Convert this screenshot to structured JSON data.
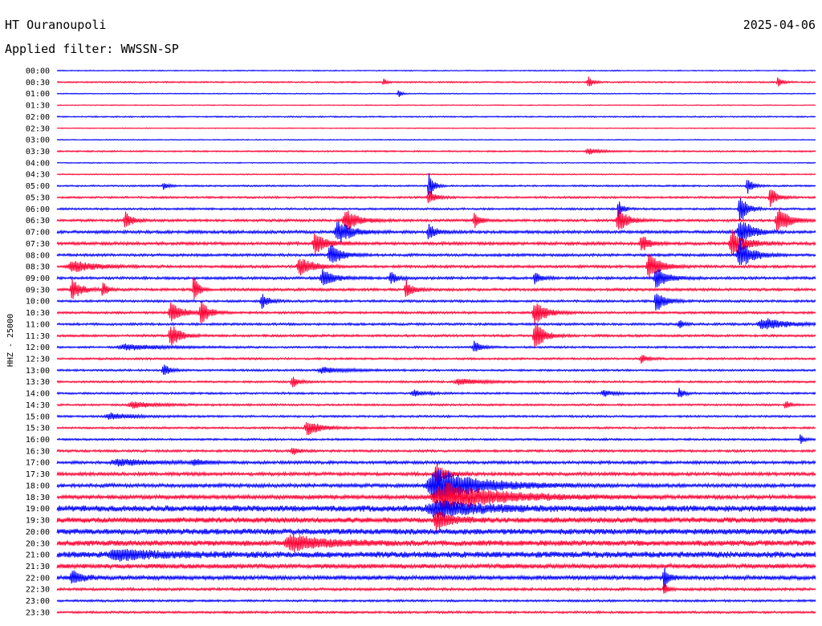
{
  "chart_data": {
    "type": "line",
    "title": "HT Ouranoupoli",
    "subtitle": "Applied filter: WWSSN-SP",
    "date": "2025-04-06",
    "ylabel": "HHZ - 25000",
    "grid": false,
    "series_colors": [
      "#0000ff",
      "#ff0033"
    ],
    "rows": [
      "00:00",
      "00:30",
      "01:00",
      "01:30",
      "02:00",
      "02:30",
      "03:00",
      "03:30",
      "04:00",
      "04:30",
      "05:00",
      "05:30",
      "06:00",
      "06:30",
      "07:00",
      "07:30",
      "08:00",
      "08:30",
      "09:00",
      "09:30",
      "10:00",
      "10:30",
      "11:00",
      "11:30",
      "12:00",
      "12:30",
      "13:00",
      "13:30",
      "14:00",
      "14:30",
      "15:00",
      "15:30",
      "16:00",
      "16:30",
      "17:00",
      "17:30",
      "18:00",
      "18:30",
      "19:00",
      "19:30",
      "20:00",
      "20:30",
      "21:00",
      "21:30",
      "22:00",
      "22:30",
      "23:00",
      "23:30"
    ],
    "row_noise": [
      0.6,
      0.9,
      0.6,
      0.5,
      0.8,
      0.5,
      0.6,
      0.9,
      0.6,
      0.7,
      1.0,
      1.2,
      1.2,
      1.5,
      1.8,
      1.8,
      1.6,
      1.6,
      1.6,
      1.6,
      1.4,
      1.4,
      1.4,
      1.4,
      1.2,
      1.2,
      1.2,
      1.2,
      1.2,
      1.2,
      1.2,
      1.2,
      1.2,
      1.4,
      1.8,
      2.0,
      2.2,
      2.4,
      3.8,
      3.4,
      3.6,
      3.4,
      3.8,
      2.8,
      2.6,
      1.6,
      1.3,
      1.3
    ],
    "events": [
      {
        "row": 1,
        "pos": 0.7,
        "amp": 8,
        "width": 0.004
      },
      {
        "row": 1,
        "pos": 0.95,
        "amp": 7,
        "width": 0.004
      },
      {
        "row": 1,
        "pos": 0.43,
        "amp": 5,
        "width": 0.003
      },
      {
        "row": 2,
        "pos": 0.45,
        "amp": 5,
        "width": 0.003
      },
      {
        "row": 7,
        "pos": 0.7,
        "amp": 4,
        "width": 0.01
      },
      {
        "row": 10,
        "pos": 0.14,
        "amp": 6,
        "width": 0.004
      },
      {
        "row": 10,
        "pos": 0.49,
        "amp": 22,
        "width": 0.004
      },
      {
        "row": 10,
        "pos": 0.91,
        "amp": 10,
        "width": 0.005
      },
      {
        "row": 11,
        "pos": 0.49,
        "amp": 10,
        "width": 0.006
      },
      {
        "row": 11,
        "pos": 0.94,
        "amp": 14,
        "width": 0.006
      },
      {
        "row": 12,
        "pos": 0.9,
        "amp": 22,
        "width": 0.006
      },
      {
        "row": 12,
        "pos": 0.74,
        "amp": 12,
        "width": 0.004
      },
      {
        "row": 13,
        "pos": 0.09,
        "amp": 12,
        "width": 0.006
      },
      {
        "row": 13,
        "pos": 0.38,
        "amp": 14,
        "width": 0.012
      },
      {
        "row": 13,
        "pos": 0.55,
        "amp": 10,
        "width": 0.006
      },
      {
        "row": 13,
        "pos": 0.74,
        "amp": 18,
        "width": 0.008
      },
      {
        "row": 13,
        "pos": 0.95,
        "amp": 18,
        "width": 0.01
      },
      {
        "row": 14,
        "pos": 0.37,
        "amp": 16,
        "width": 0.012
      },
      {
        "row": 14,
        "pos": 0.49,
        "amp": 12,
        "width": 0.006
      },
      {
        "row": 14,
        "pos": 0.9,
        "amp": 20,
        "width": 0.01
      },
      {
        "row": 15,
        "pos": 0.34,
        "amp": 14,
        "width": 0.01
      },
      {
        "row": 15,
        "pos": 0.77,
        "amp": 14,
        "width": 0.006
      },
      {
        "row": 15,
        "pos": 0.89,
        "amp": 18,
        "width": 0.012
      },
      {
        "row": 16,
        "pos": 0.36,
        "amp": 14,
        "width": 0.01
      },
      {
        "row": 16,
        "pos": 0.9,
        "amp": 18,
        "width": 0.012
      },
      {
        "row": 17,
        "pos": 0.02,
        "amp": 8,
        "width": 0.02
      },
      {
        "row": 17,
        "pos": 0.32,
        "amp": 12,
        "width": 0.012
      },
      {
        "row": 17,
        "pos": 0.78,
        "amp": 18,
        "width": 0.01
      },
      {
        "row": 18,
        "pos": 0.35,
        "amp": 12,
        "width": 0.01
      },
      {
        "row": 18,
        "pos": 0.44,
        "amp": 8,
        "width": 0.006
      },
      {
        "row": 18,
        "pos": 0.63,
        "amp": 8,
        "width": 0.006
      },
      {
        "row": 18,
        "pos": 0.79,
        "amp": 14,
        "width": 0.01
      },
      {
        "row": 19,
        "pos": 0.02,
        "amp": 14,
        "width": 0.008
      },
      {
        "row": 19,
        "pos": 0.06,
        "amp": 10,
        "width": 0.004
      },
      {
        "row": 19,
        "pos": 0.18,
        "amp": 24,
        "width": 0.004
      },
      {
        "row": 19,
        "pos": 0.46,
        "amp": 12,
        "width": 0.006
      },
      {
        "row": 20,
        "pos": 0.27,
        "amp": 10,
        "width": 0.006
      },
      {
        "row": 20,
        "pos": 0.79,
        "amp": 14,
        "width": 0.008
      },
      {
        "row": 21,
        "pos": 0.15,
        "amp": 14,
        "width": 0.01
      },
      {
        "row": 21,
        "pos": 0.19,
        "amp": 14,
        "width": 0.008
      },
      {
        "row": 21,
        "pos": 0.63,
        "amp": 16,
        "width": 0.01
      },
      {
        "row": 22,
        "pos": 0.93,
        "amp": 8,
        "width": 0.02
      },
      {
        "row": 22,
        "pos": 0.82,
        "amp": 6,
        "width": 0.004
      },
      {
        "row": 23,
        "pos": 0.15,
        "amp": 16,
        "width": 0.008
      },
      {
        "row": 23,
        "pos": 0.63,
        "amp": 20,
        "width": 0.008
      },
      {
        "row": 24,
        "pos": 0.09,
        "amp": 4,
        "width": 0.03
      },
      {
        "row": 24,
        "pos": 0.55,
        "amp": 8,
        "width": 0.006
      },
      {
        "row": 25,
        "pos": 0.77,
        "amp": 6,
        "width": 0.006
      },
      {
        "row": 26,
        "pos": 0.14,
        "amp": 8,
        "width": 0.006
      },
      {
        "row": 26,
        "pos": 0.35,
        "amp": 4,
        "width": 0.02
      },
      {
        "row": 27,
        "pos": 0.31,
        "amp": 7,
        "width": 0.006
      },
      {
        "row": 27,
        "pos": 0.53,
        "amp": 4,
        "width": 0.02
      },
      {
        "row": 28,
        "pos": 0.47,
        "amp": 4,
        "width": 0.01
      },
      {
        "row": 28,
        "pos": 0.72,
        "amp": 4,
        "width": 0.01
      },
      {
        "row": 28,
        "pos": 0.82,
        "amp": 8,
        "width": 0.004
      },
      {
        "row": 29,
        "pos": 0.1,
        "amp": 4,
        "width": 0.02
      },
      {
        "row": 29,
        "pos": 0.96,
        "amp": 7,
        "width": 0.004
      },
      {
        "row": 30,
        "pos": 0.07,
        "amp": 4,
        "width": 0.02
      },
      {
        "row": 31,
        "pos": 0.33,
        "amp": 10,
        "width": 0.012
      },
      {
        "row": 32,
        "pos": 0.98,
        "amp": 7,
        "width": 0.004
      },
      {
        "row": 33,
        "pos": 0.31,
        "amp": 5,
        "width": 0.006
      },
      {
        "row": 34,
        "pos": 0.08,
        "amp": 4,
        "width": 0.03
      },
      {
        "row": 34,
        "pos": 0.18,
        "amp": 4,
        "width": 0.01
      },
      {
        "row": 35,
        "pos": 0.5,
        "amp": 14,
        "width": 0.008
      },
      {
        "row": 36,
        "pos": 0.5,
        "amp": 22,
        "width": 0.04
      },
      {
        "row": 37,
        "pos": 0.51,
        "amp": 18,
        "width": 0.05
      },
      {
        "row": 38,
        "pos": 0.5,
        "amp": 10,
        "width": 0.04
      },
      {
        "row": 39,
        "pos": 0.5,
        "amp": 14,
        "width": 0.012
      },
      {
        "row": 41,
        "pos": 0.31,
        "amp": 10,
        "width": 0.03
      },
      {
        "row": 42,
        "pos": 0.08,
        "amp": 6,
        "width": 0.04
      },
      {
        "row": 44,
        "pos": 0.02,
        "amp": 8,
        "width": 0.01
      },
      {
        "row": 44,
        "pos": 0.8,
        "amp": 14,
        "width": 0.004
      },
      {
        "row": 45,
        "pos": 0.8,
        "amp": 8,
        "width": 0.004
      }
    ]
  }
}
